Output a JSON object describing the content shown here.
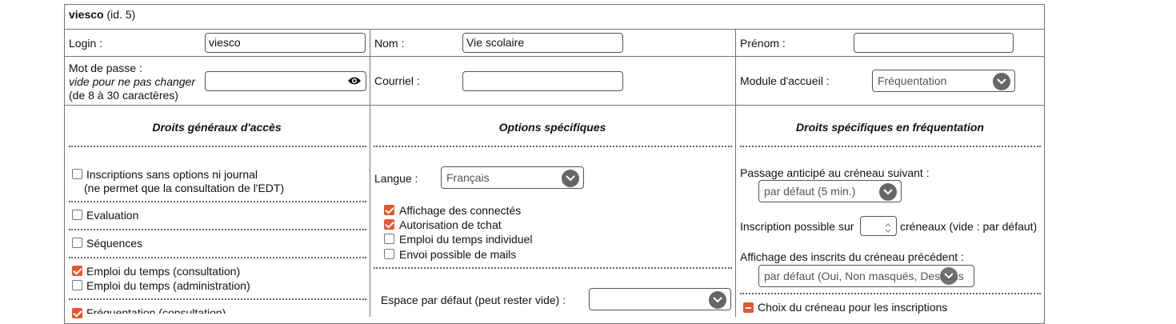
{
  "header": {
    "name": "viesco",
    "id_text": "(id. 5)"
  },
  "row1": {
    "login_label": "Login :",
    "login_value": "viesco",
    "nom_label": "Nom :",
    "nom_value": "Vie scolaire",
    "prenom_label": "Prénom :",
    "prenom_value": ""
  },
  "row2": {
    "password_label": "Mot de passe :",
    "password_hint1": "vide pour ne pas changer",
    "password_hint2": "(de 8 à 30 caractères)",
    "password_value": "",
    "email_label": "Courriel :",
    "email_value": "",
    "module_label": "Module d'accueil :",
    "module_value": "Fréquentation"
  },
  "col1": {
    "heading": "Droits généraux d'accès",
    "items": [
      {
        "label": "Inscriptions sans options ni journal",
        "sub": "(ne permet que la consultation de l'EDT)",
        "checked": false
      },
      {
        "label": "Evaluation",
        "checked": false
      },
      {
        "label": "Séquences",
        "checked": false
      },
      {
        "label": "Emploi du temps (consultation)",
        "checked": true
      },
      {
        "label": "Emploi du temps (administration)",
        "checked": false
      },
      {
        "label": "Fréquentation (consultation)",
        "checked": true
      }
    ]
  },
  "col2": {
    "heading": "Options spécifiques",
    "langue_label": "Langue :",
    "langue_value": "Français",
    "options": [
      {
        "label": "Affichage des connectés",
        "checked": true
      },
      {
        "label": "Autorisation de tchat",
        "checked": true
      },
      {
        "label": "Emploi du temps individuel",
        "checked": false
      },
      {
        "label": "Envoi possible de mails",
        "checked": false
      }
    ],
    "espace_label": "Espace par défaut (peut rester vide) :",
    "espace_value": ""
  },
  "col3": {
    "heading": "Droits spécifiques en fréquentation",
    "passage_label": "Passage anticipé au créneau suivant :",
    "passage_value": "par défaut (5 min.)",
    "inscription_label": "Inscription possible sur",
    "inscription_value": "",
    "inscription_suffix": "créneaux (vide : par défaut)",
    "affichage_label": "Affichage des inscrits du créneau précédent :",
    "affichage_value": "par défaut (Oui, Non masqués, Dessous",
    "choix_label": "Choix du créneau pour les inscriptions"
  },
  "colors": {
    "accent": "#e8562e",
    "border": "#777777"
  },
  "icons": {
    "password_toggle": "eye-icon",
    "select_arrow": "chevron-down-icon"
  }
}
